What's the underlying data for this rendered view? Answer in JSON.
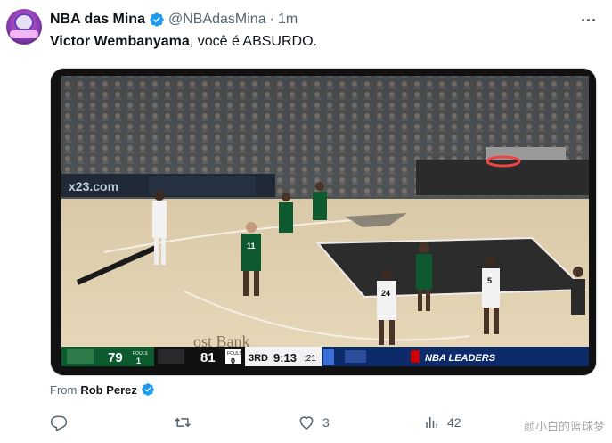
{
  "tweet": {
    "author_name": "NBA das Mina",
    "handle": "@NBAdasMina",
    "separator": "·",
    "time": "1m",
    "text_bold": "Victor Wembanyama",
    "text_rest": ", você é ABSURDO.",
    "from_label": "From",
    "from_source": "Rob Perez"
  },
  "video": {
    "scorebug": {
      "home_score": "79",
      "home_fouls_label": "FOULS",
      "home_fouls": "1",
      "away_score": "81",
      "away_fouls_label": "FOULS",
      "away_fouls": "0",
      "quarter": "3RD",
      "clock": "9:13",
      "shot_clock": ":21",
      "ticker": "NBA LEADERS",
      "home_color": "#0b5b2f",
      "away_color": "#111111"
    },
    "arena_sign": "ost Bank",
    "jersey_numbers": [
      "11",
      "24",
      "5"
    ]
  },
  "actions": {
    "replies": "",
    "reposts": "",
    "likes": "3",
    "views": "42"
  },
  "watermark": "颜小白的篮球梦",
  "colors": {
    "verified": "#1d9bf0",
    "muted": "#536471"
  }
}
